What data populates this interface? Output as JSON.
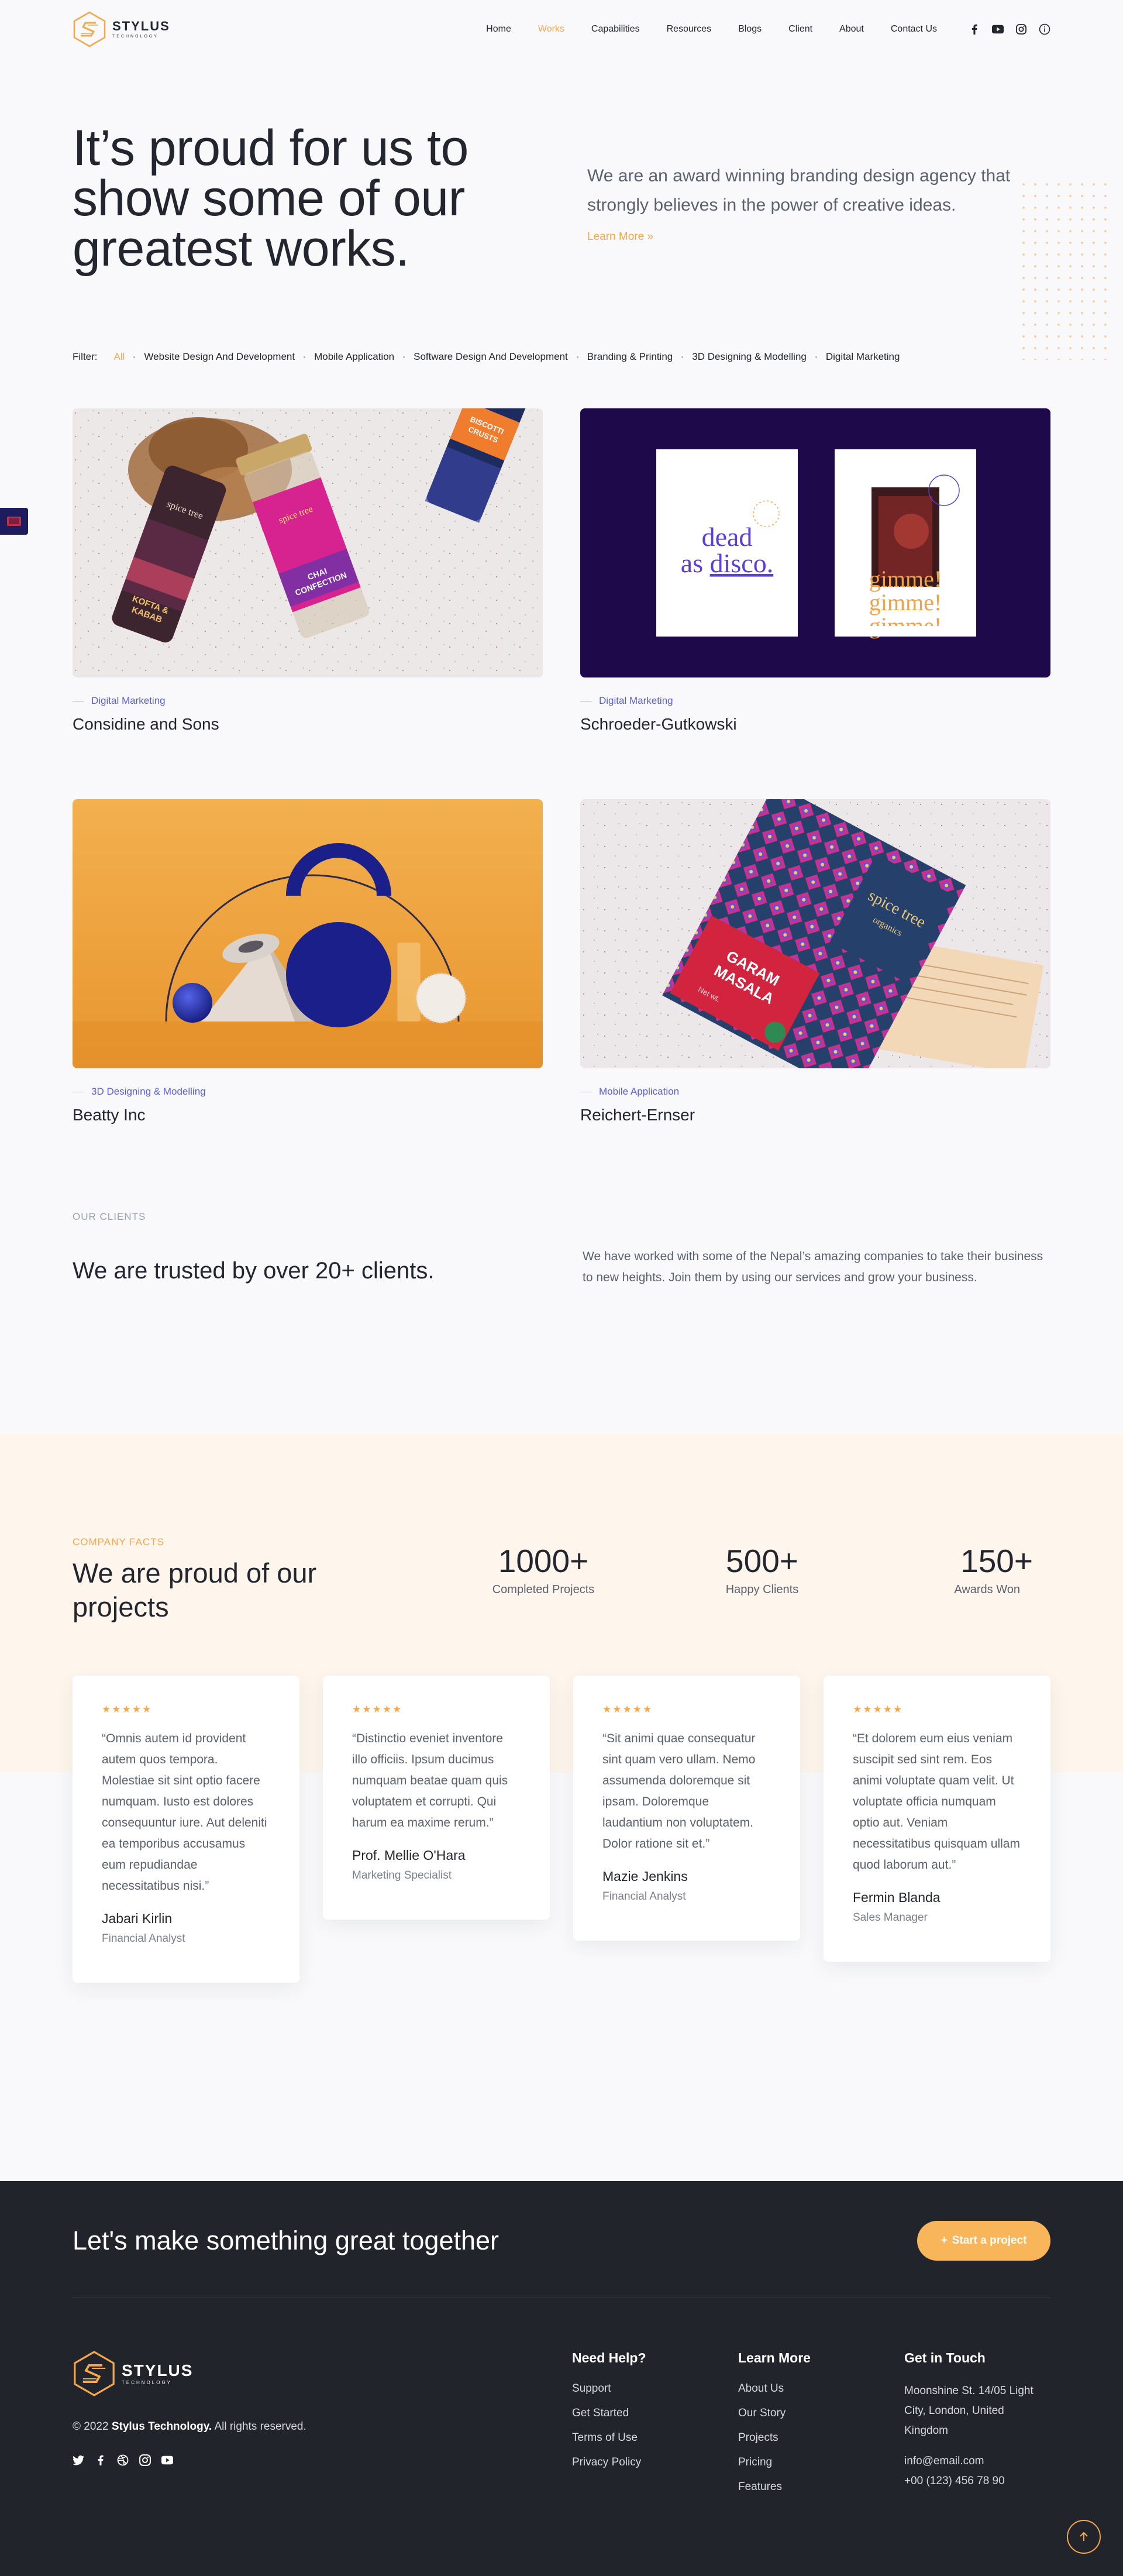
{
  "brand": {
    "name": "STYLUS",
    "tagline": "TECHNOLOGY"
  },
  "nav": [
    {
      "label": "Home",
      "active": false
    },
    {
      "label": "Works",
      "active": true
    },
    {
      "label": "Capabilities",
      "active": false
    },
    {
      "label": "Resources",
      "active": false
    },
    {
      "label": "Blogs",
      "active": false
    },
    {
      "label": "Client",
      "active": false
    },
    {
      "label": "About",
      "active": false
    },
    {
      "label": "Contact Us",
      "active": false
    }
  ],
  "header_social": [
    "facebook-icon",
    "youtube-icon",
    "instagram-icon",
    "info-icon"
  ],
  "hero": {
    "title": "It’s proud for us to show some of our greatest works.",
    "description": "We are an award winning branding design agency that strongly believes in the power of creative ideas.",
    "link": "Learn More »"
  },
  "filters": {
    "label": "Filter:",
    "items": [
      {
        "label": "All",
        "active": true
      },
      {
        "label": "Website Design And Development",
        "active": false
      },
      {
        "label": "Mobile Application",
        "active": false
      },
      {
        "label": "Software Design And Development",
        "active": false
      },
      {
        "label": "Branding & Printing",
        "active": false
      },
      {
        "label": "3D Designing & Modelling",
        "active": false
      },
      {
        "label": "Digital Marketing",
        "active": false
      }
    ]
  },
  "works": [
    {
      "category": "Digital Marketing",
      "title": "Considine and Sons"
    },
    {
      "category": "Digital Marketing",
      "title": "Schroeder-Gutkowski"
    },
    {
      "category": "3D Designing & Modelling",
      "title": "Beatty Inc"
    },
    {
      "category": "Mobile Application",
      "title": "Reichert-Ernser"
    }
  ],
  "work_images": {
    "jar1": {
      "lines": [
        "spice tree",
        "KOFTA &",
        "KABAB"
      ]
    },
    "jar2": {
      "lines": [
        "spice tree",
        "CHAI",
        "CONFECTION"
      ]
    },
    "jar3": {
      "lines": [
        "BISCOTTI",
        "CRUSTS"
      ]
    },
    "poster1": {
      "line1": "dead",
      "line2a": "as ",
      "line2b": "disco."
    },
    "poster2": {
      "lines": [
        "gimme!",
        "gimme!",
        "gimme!"
      ]
    },
    "box": {
      "brand": "spice tree",
      "sub": "organics",
      "product1": "GARAM",
      "product2": "MASALA",
      "note": "Net wt."
    }
  },
  "clients": {
    "eyebrow": "OUR CLIENTS",
    "title": "We are trusted by over 20+ clients.",
    "description": "We have worked with some of the Nepal’s amazing companies to take their business to new heights. Join them by using our services and grow your business."
  },
  "facts": {
    "eyebrow": "COMPANY FACTS",
    "title": "We are proud of our projects",
    "stats": [
      {
        "value": "1000+",
        "label": "Completed Projects"
      },
      {
        "value": "500+",
        "label": "Happy Clients"
      },
      {
        "value": "150+",
        "label": "Awards Won"
      }
    ]
  },
  "testimonials": [
    {
      "stars": "★★★★★",
      "rating": 5,
      "quote": "“Omnis autem id provident autem quos tempora. Molestiae sit sint optio facere numquam. Iusto est dolores consequuntur iure. Aut deleniti ea temporibus accusamus eum repudiandae necessitatibus nisi.”",
      "name": "Jabari Kirlin",
      "role": "Financial Analyst"
    },
    {
      "stars": "★★★★★",
      "rating": 5,
      "quote": "“Distinctio eveniet inventore illo officiis. Ipsum ducimus numquam beatae quam quis voluptatem et corrupti. Qui harum ea maxime rerum.”",
      "name": "Prof. Mellie O'Hara",
      "role": "Marketing Specialist"
    },
    {
      "stars": "★★★★★",
      "rating": 5,
      "quote": "“Sit animi quae consequatur sint quam vero ullam. Nemo assumenda doloremque sit ipsam. Doloremque laudantium non voluptatem. Dolor ratione sit et.”",
      "name": "Mazie Jenkins",
      "role": "Financial Analyst"
    },
    {
      "stars": "★★★★★",
      "rating": 5,
      "quote": "“Et dolorem eum eius veniam suscipit sed sint rem. Eos animi voluptate quam velit. Ut voluptate officia numquam optio aut. Veniam necessitatibus quisquam ullam quod laborum aut.”",
      "name": "Fermin Blanda",
      "role": "Sales Manager"
    }
  ],
  "footer": {
    "cta_title": "Let's make something great together",
    "cta_button": "Start a project",
    "copyright_prefix": "© 2022",
    "copyright_brand": "Stylus Technology.",
    "copyright_suffix": "All rights reserved.",
    "social": [
      "twitter-icon",
      "facebook-icon",
      "dribbble-icon",
      "instagram-icon",
      "youtube-icon"
    ],
    "help": {
      "title": "Need Help?",
      "links": [
        "Support",
        "Get Started",
        "Terms of Use",
        "Privacy Policy"
      ]
    },
    "learn": {
      "title": "Learn More",
      "links": [
        "About Us",
        "Our Story",
        "Projects",
        "Pricing",
        "Features"
      ]
    },
    "touch": {
      "title": "Get in Touch",
      "address": "Moonshine St. 14/05 Light City, London, United Kingdom",
      "email": "info@email.com",
      "phone": "+00 (123) 456 78 90"
    }
  },
  "colors": {
    "accent": "#f5a74b",
    "category": "#5a5fd6",
    "dark": "#22242b",
    "facts_bg": "#fef6ec",
    "poster_bg": "#1e0a4a"
  }
}
